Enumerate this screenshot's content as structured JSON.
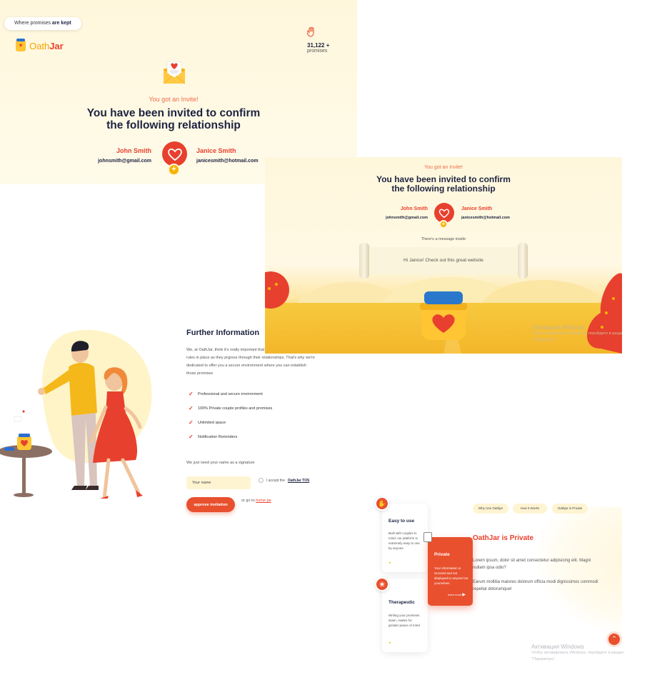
{
  "hero": {
    "tagline_plain": "Where promises ",
    "tagline_bold": "are kept",
    "logo_part1": "Oath",
    "logo_part2": "Jar",
    "counter_value": "31,122 +",
    "counter_label": "promises",
    "invite_label": "You got an Invite!",
    "title_line1": "You have been invited to confirm",
    "title_line2": "the following relationship",
    "person1_name": "John Smith",
    "person1_email": "johnsmith@gmail.com",
    "person2_name": "Janice Smith",
    "person2_email": "janicesmith@hotmail.com"
  },
  "message_panel": {
    "invite_label": "You got an Invite!",
    "title_line1": "You have been invited to confirm",
    "title_line2": "the following relationship",
    "person1_name": "John Smith",
    "person1_email": "johnsmith@gmail.com",
    "person2_name": "Janice Smith",
    "person2_email": "janicesmith@hotmail.com",
    "message_intro": "There's a message inside",
    "message_text": "Hi Janice! Check out this great website",
    "watermark_title": "Активация Windows",
    "watermark_text": "Чтобы активировать Windows, перейдите в раздел \"Параметры\"."
  },
  "further_info": {
    "title": "Further Information",
    "description": "We, at OathJar, think it's really important that couples have some ground rules in place as they prgress through their relationships. That's why we're dedicated to offer you a secure environment where you can establish those promises",
    "features": [
      "Professional and secure environment",
      "100% Private couple profiles and promises",
      "Unlimited space",
      "Notification Reminders"
    ],
    "signature_label": "We just need your name as a signature",
    "name_placeholder": "Your name",
    "tos_prefix": "I accept the ",
    "tos_link": "OathJar TOS",
    "approve_label": "approve invitation",
    "goto_prefix": "or go to ",
    "goto_link": "home pa"
  },
  "features_panel": {
    "tabs": [
      "Why Use Oathjar",
      "How it Works",
      "Oathjar is Private"
    ],
    "cards": [
      {
        "title": "Easy to use",
        "text": "Built with couples in mind, our platform is extremely easy to use by anyone"
      },
      {
        "title": "Private",
        "text": "Your information is secured and not displayed to anyone but yourselves",
        "link": "learn more"
      },
      {
        "title": "Therapeutic",
        "text": "Writing your promises down, makes for greater peace of mind"
      }
    ],
    "title": "OathJar is Private",
    "para1": "Lorem ipsum, dolor sit amet consectetur adipisicing elit. Magni nullam ipsa odio?",
    "para2": "Earum mollitia maiores dolorum officia modi dignissimos commodi repellat dolorumque!",
    "watermark_title": "Активация Windows",
    "watermark_text": "Чтобы активировать Windows, перейдите в раздел \"Параметры\"."
  },
  "colors": {
    "brand_red": "#e8402e",
    "brand_orange": "#e8502e",
    "brand_yellow": "#f5b400",
    "navy": "#1d2340",
    "cream": "#fff7dc"
  },
  "icons": {
    "counter": "hand-icon",
    "scroll_top": "chevron-up-icon"
  }
}
